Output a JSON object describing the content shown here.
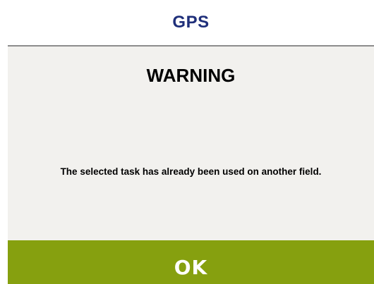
{
  "dialog": {
    "header_title": "GPS",
    "warning_title": "WARNING",
    "message": "The selected task has already been used on another field.",
    "ok_label": "OK"
  },
  "colors": {
    "header_text": "#1f2f7a",
    "dialog_background": "#f2f1ee",
    "ok_button": "#86a00f",
    "header_divider": "#8c8c8c"
  }
}
